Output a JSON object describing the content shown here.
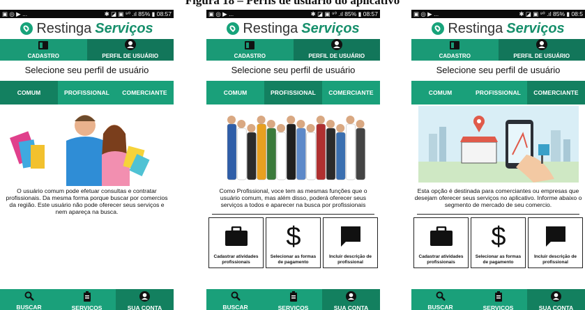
{
  "caption": "Figura 18 – Perfis de usuário do aplicativo",
  "colors": {
    "brand": "#1aa07a",
    "brand_dark": "#13805f"
  },
  "phones": [
    {
      "status_left": "▣ ◎ ▶ ...",
      "status_right": "✱ ◪ ▣ ⁹⁰ .ıl 85% ▮ 08:57",
      "logo_name": "Restinga",
      "logo_accent": "Serviços",
      "tabs": [
        "CADASTRO",
        "PERFIL DE USUÁRIO"
      ],
      "page_title": "Selecione seu perfil de usuário",
      "subtabs": [
        "COMUM",
        "PROFISSIONAL",
        "COMERCIANTE"
      ],
      "active_subtab": 0,
      "description": "O usuário comum pode efetuar consultas e contratar profissionais. Da mesma forma porque buscar por comercios da região. Este usuário não pode oferecer seus serviços e nem apareça na busca.",
      "cards": [],
      "nav": [
        "BUSCAR",
        "SERVIÇOS",
        "SUA CONTA"
      ]
    },
    {
      "status_left": "▣ ◎ ▶ ...",
      "status_right": "✱ ◪ ▣ ⁹⁰ .ıl 85% ▮ 08:57",
      "logo_name": "Restinga",
      "logo_accent": "Serviços",
      "tabs": [
        "CADASTRO",
        "PERFIL DE USUÁRIO"
      ],
      "page_title": "Selecione seu perfil de usuário",
      "subtabs": [
        "COMUM",
        "PROFISSIONAL",
        "COMERCIANTE"
      ],
      "active_subtab": 1,
      "description": "Como Profissional, voce tem as mesmas funções que o usuário comum, mas além disso, poderá oferecer seus serviços a todos e aparecer na busca por profissionais",
      "cards": [
        "Cadastrar atividades profissionais",
        "Selecionar as formas de pagamento",
        "Incluir descrição de profissional"
      ],
      "nav": [
        "BUSCAR",
        "SERVIÇOS",
        "SUA CONTA"
      ]
    },
    {
      "status_left": "▣ ◎ ▶ ...",
      "status_right": "✱ ◪ ▣ ⁹⁰ .ıl 85% ▮ 08:5",
      "logo_name": "Restinga",
      "logo_accent": "Serviços",
      "tabs": [
        "CADASTRO",
        "PERFIL DE USUÁRIO"
      ],
      "page_title": "Selecione seu perfil de usuário",
      "subtabs": [
        "COMUM",
        "PROFISSIONAL",
        "COMERCIANTE"
      ],
      "active_subtab": 2,
      "description": "Esta opção é destinada para comerciantes ou empresas que desejam oferecer seus serviços no aplicativo. Informe abaixo o segmento de mercado de seu comercio.",
      "cards": [
        "Cadastrar atividades profissionais",
        "Selecionar as formas de pagamento",
        "Incluir descrição de profissional"
      ],
      "nav": [
        "BUSCAR",
        "SERVIÇOS",
        "SUA CONTA"
      ]
    }
  ]
}
